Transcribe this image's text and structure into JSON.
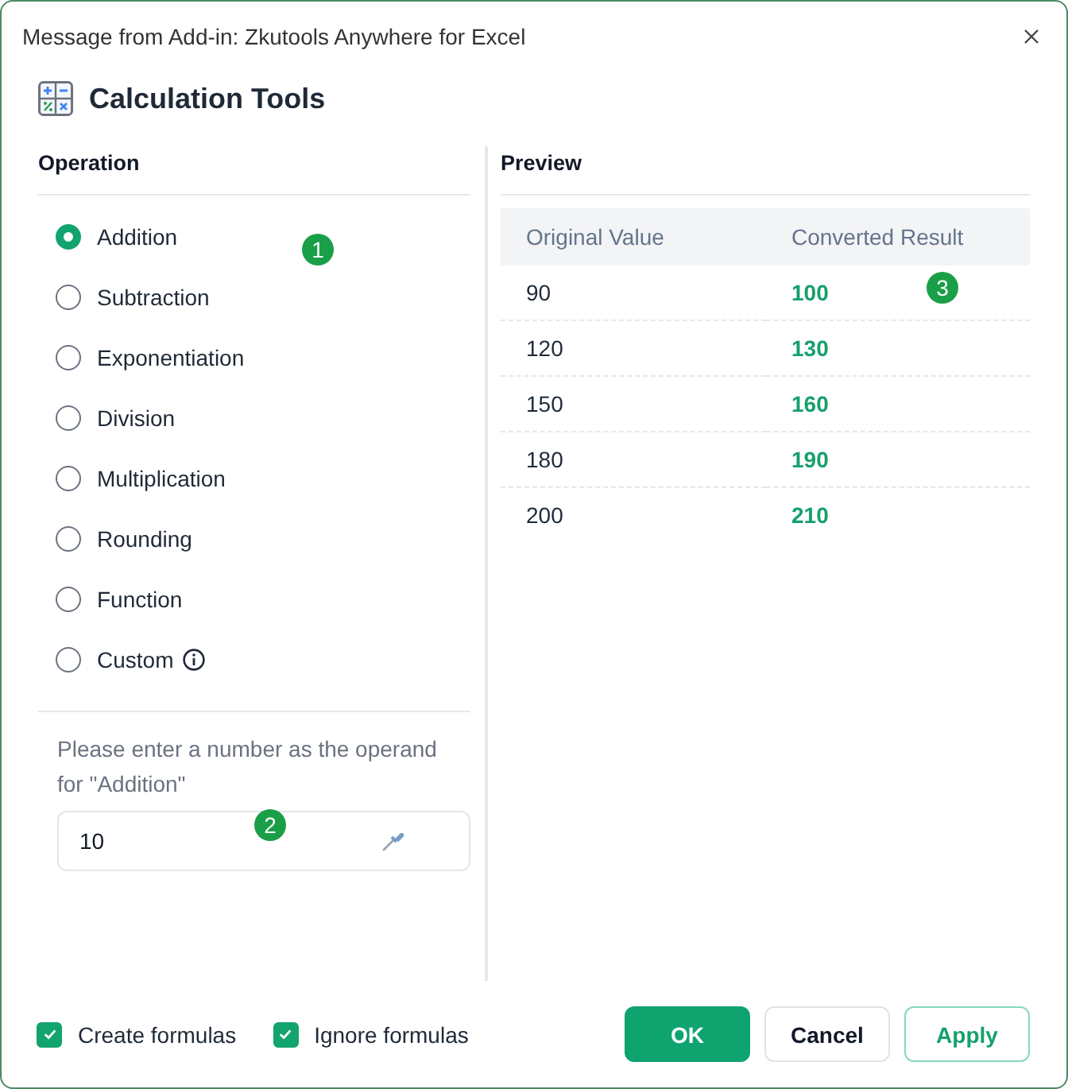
{
  "window": {
    "title": "Message from Add-in: Zkutools Anywhere for Excel"
  },
  "header": {
    "title": "Calculation Tools"
  },
  "operation": {
    "heading": "Operation",
    "callout": "1",
    "options": [
      {
        "label": "Addition",
        "selected": true,
        "info": false
      },
      {
        "label": "Subtraction",
        "selected": false,
        "info": false
      },
      {
        "label": "Exponentiation",
        "selected": false,
        "info": false
      },
      {
        "label": "Division",
        "selected": false,
        "info": false
      },
      {
        "label": "Multiplication",
        "selected": false,
        "info": false
      },
      {
        "label": "Rounding",
        "selected": false,
        "info": false
      },
      {
        "label": "Function",
        "selected": false,
        "info": false
      },
      {
        "label": "Custom",
        "selected": false,
        "info": true
      }
    ],
    "prompt": "Please enter a number as the operand for \"Addition\"",
    "operand": {
      "value": "10",
      "callout": "2"
    }
  },
  "preview": {
    "heading": "Preview",
    "callout": "3",
    "columns": [
      "Original Value",
      "Converted Result"
    ],
    "rows": [
      [
        "90",
        "100"
      ],
      [
        "120",
        "130"
      ],
      [
        "150",
        "160"
      ],
      [
        "180",
        "190"
      ],
      [
        "200",
        "210"
      ]
    ]
  },
  "footer": {
    "checkboxes": [
      {
        "label": "Create formulas",
        "checked": true
      },
      {
        "label": "Ignore formulas",
        "checked": true
      }
    ],
    "buttons": [
      {
        "label": "OK",
        "kind": "primary"
      },
      {
        "label": "Cancel",
        "kind": "default"
      },
      {
        "label": "Apply",
        "kind": "outline"
      }
    ]
  }
}
